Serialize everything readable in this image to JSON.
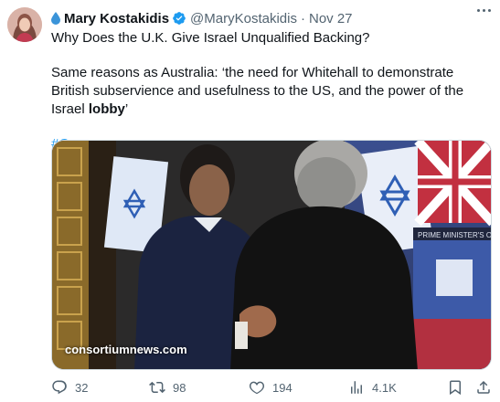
{
  "author": {
    "name": "Mary Kostakidis",
    "handle": "@MaryKostakidis",
    "separator": "·",
    "date": "Nov 27"
  },
  "tweet": {
    "line1": "Why Does the U.K. Give Israel Unqualified Backing?",
    "line2_start": "Same reasons as Australia: ‘the need for Whitehall to demonstrate British subservience and usefulness to the US, and the power of the Israel ",
    "line2_bold": "lobby",
    "line2_end": "’",
    "hashtag": "#Gaza"
  },
  "media": {
    "watermark": "consortiumnews.com",
    "sign_text": "PRIME MINISTER'S OF"
  },
  "actions": {
    "replies": "32",
    "reposts": "98",
    "likes": "194",
    "views": "4.1K"
  },
  "colors": {
    "accent": "#1d9bf0",
    "muted": "#536471"
  }
}
